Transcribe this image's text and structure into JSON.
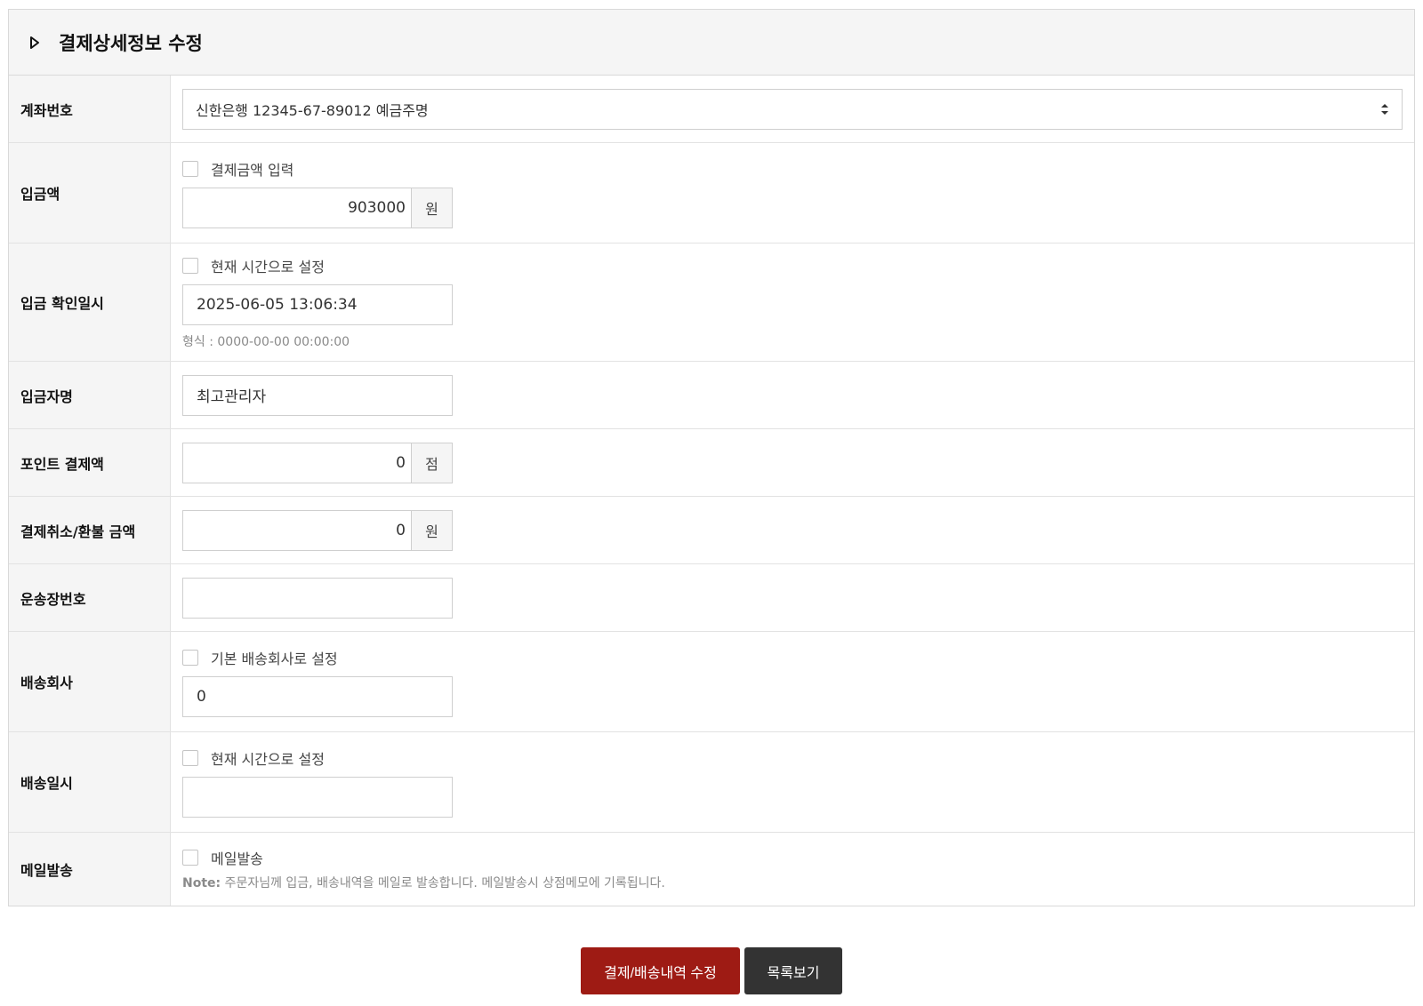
{
  "header": {
    "title": "결제상세정보 수정"
  },
  "rows": {
    "account": {
      "label": "계좌번호",
      "selected": "신한은행 12345-67-89012 예금주명"
    },
    "deposit_amount": {
      "label": "입금액",
      "checkbox_label": "결제금액 입력",
      "value": "903000",
      "unit": "원"
    },
    "deposit_time": {
      "label": "입금 확인일시",
      "checkbox_label": "현재 시간으로 설정",
      "value": "2025-06-05 13:06:34",
      "hint": "형식 : 0000-00-00 00:00:00"
    },
    "depositor": {
      "label": "입금자명",
      "value": "최고관리자"
    },
    "point_amount": {
      "label": "포인트 결제액",
      "value": "0",
      "unit": "점"
    },
    "refund_amount": {
      "label": "결제취소/환불 금액",
      "value": "0",
      "unit": "원"
    },
    "tracking_no": {
      "label": "운송장번호",
      "value": ""
    },
    "courier": {
      "label": "배송회사",
      "checkbox_label": "기본 배송회사로 설정",
      "value": "0"
    },
    "ship_time": {
      "label": "배송일시",
      "checkbox_label": "현재 시간으로 설정",
      "value": ""
    },
    "mail": {
      "label": "메일발송",
      "checkbox_label": "메일발송",
      "note_prefix": "Note:",
      "note_text": " 주문자님께 입금, 배송내역을 메일로 발송합니다. 메일발송시 상점메모에 기록됩니다."
    }
  },
  "buttons": {
    "submit": "결제/배송내역 수정",
    "list": "목록보기"
  },
  "colors": {
    "primary": "#9e1b14",
    "dark": "#333333",
    "label_bg": "#f5f5f5"
  }
}
